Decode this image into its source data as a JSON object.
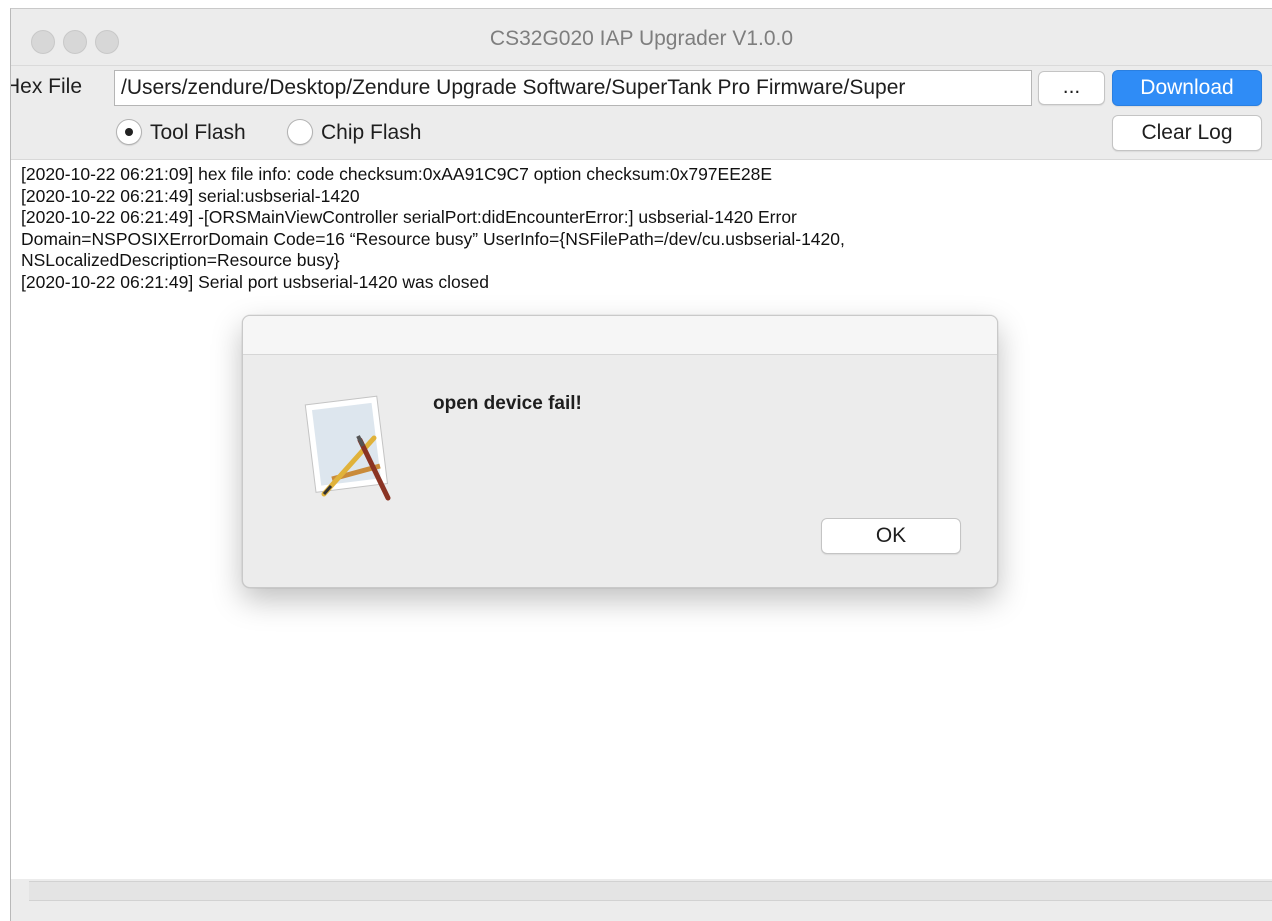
{
  "window": {
    "title": "CS32G020 IAP Upgrader V1.0.0"
  },
  "toolbar": {
    "hex_file_label": "Hex File",
    "hex_file_path": "/Users/zendure/Desktop/Zendure Upgrade Software/SuperTank Pro Firmware/Super",
    "browse_label": "...",
    "download_label": "Download",
    "clear_log_label": "Clear Log"
  },
  "flash_mode": {
    "options": [
      {
        "label": "Tool Flash",
        "selected": true
      },
      {
        "label": "Chip Flash",
        "selected": false
      }
    ]
  },
  "log": {
    "lines": [
      "[2020-10-22 06:21:09]  hex file info: code checksum:0xAA91C9C7    option checksum:0x797EE28E",
      "[2020-10-22 06:21:49]  serial:usbserial-1420",
      "[2020-10-22 06:21:49]  -[ORSMainViewController serialPort:didEncounterError:] usbserial-1420 Error",
      "Domain=NSPOSIXErrorDomain Code=16 “Resource busy” UserInfo={NSFilePath=/dev/cu.usbserial-1420,",
      "NSLocalizedDescription=Resource busy}",
      "[2020-10-22 06:21:49]  Serial port usbserial-1420 was closed"
    ]
  },
  "dialog": {
    "message": "open device fail!",
    "ok_label": "OK",
    "icon": "app-icon"
  },
  "colors": {
    "accent": "#2f8cf6",
    "window_bg": "#ececec"
  }
}
